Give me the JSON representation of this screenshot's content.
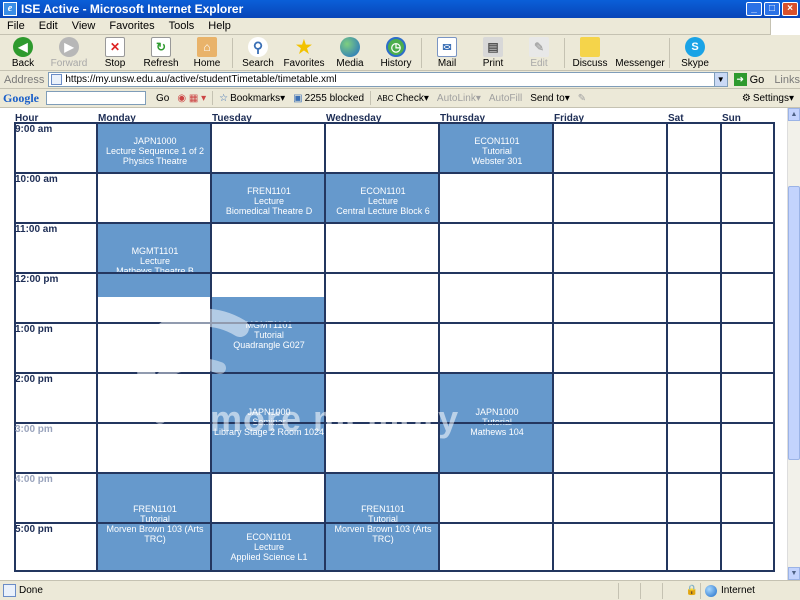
{
  "window": {
    "title": "ISE Active - Microsoft Internet Explorer"
  },
  "menu": [
    "File",
    "Edit",
    "View",
    "Favorites",
    "Tools",
    "Help"
  ],
  "toolbar": {
    "back": "Back",
    "forward": "Forward",
    "stop": "Stop",
    "refresh": "Refresh",
    "home": "Home",
    "search": "Search",
    "favorites": "Favorites",
    "media": "Media",
    "history": "History",
    "mail": "Mail",
    "print": "Print",
    "edit": "Edit",
    "discuss": "Discuss",
    "messenger": "Messenger",
    "skype": "Skype"
  },
  "address": {
    "label": "Address",
    "url": "https://my.unsw.edu.au/active/studentTimetable/timetable.xml",
    "go": "Go",
    "links": "Links"
  },
  "google": {
    "logo": "Google",
    "go": "Go",
    "bookmarks": "Bookmarks",
    "blocked": "2255 blocked",
    "check": "Check",
    "autolink": "AutoLink",
    "autofill": "AutoFill",
    "sendto": "Send to",
    "settings": "Settings"
  },
  "timetable": {
    "headers": [
      "Hour",
      "Monday",
      "Tuesday",
      "Wednesday",
      "Thursday",
      "Friday",
      "Sat",
      "Sun"
    ],
    "hours": [
      "9:00 am",
      "10:00 am",
      "11:00 am",
      "12:00 pm",
      "1:00 pm",
      "2:00 pm",
      "3:00 pm",
      "4:00 pm",
      "5:00 pm"
    ],
    "events": [
      {
        "lines": [
          "JAPN1000",
          "Lecture Sequence 1 of 2",
          "Physics Theatre"
        ]
      },
      {
        "lines": [
          "ECON1101",
          "Tutorial",
          "Webster 301"
        ]
      },
      {
        "lines": [
          "FREN1101",
          "Lecture",
          "Biomedical Theatre D"
        ]
      },
      {
        "lines": [
          "ECON1101",
          "Lecture",
          "Central Lecture Block 6"
        ]
      },
      {
        "lines": [
          "MGMT1101",
          "Lecture",
          "Mathews Theatre B"
        ]
      },
      {
        "lines": [
          "MGMT1101",
          "Tutorial",
          "Quadrangle G027"
        ]
      },
      {
        "lines": [
          "JAPN1000",
          "Seminar",
          "Library Stage 2 Room 1024"
        ]
      },
      {
        "lines": [
          "JAPN1000",
          "Tutorial",
          "Mathews 104"
        ]
      },
      {
        "lines": [
          "FREN1101",
          "Tutorial",
          "Morven Brown 103 (Arts",
          "TRC)"
        ]
      },
      {
        "lines": [
          "ECON1101",
          "Lecture",
          "Applied Science L1"
        ]
      },
      {
        "lines": [
          "FREN1101",
          "Tutorial",
          "Morven Brown 103 (Arts",
          "TRC)"
        ]
      }
    ]
  },
  "watermark": {
    "text": "more memory"
  },
  "status": {
    "text": "Done",
    "zone": "Internet"
  },
  "colors": {
    "event": "#6699cc",
    "event_light": "#c3d6ec",
    "grid": "#23365f",
    "titlebar": "#0a5fd8"
  }
}
